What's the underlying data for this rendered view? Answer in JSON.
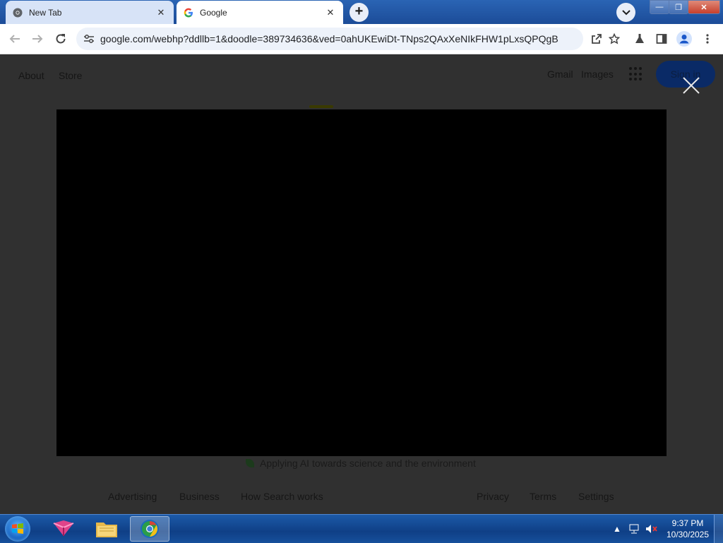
{
  "browser": {
    "tabs": [
      {
        "title": "New Tab",
        "favicon": "chrome-icon",
        "active": false
      },
      {
        "title": "Google",
        "favicon": "google-g-icon",
        "active": true
      }
    ],
    "new_tab_symbol": "+",
    "address_bar": {
      "url": "google.com/webhp?ddllb=1&doodle=389734636&ved=0ahUKEwiDt-TNps2QAxXeNIkFHW1pLxsQPQgB"
    },
    "window_controls": {
      "minimize": "—",
      "restore": "❐",
      "close": "✕"
    }
  },
  "page": {
    "top_left_links": [
      "About",
      "Store"
    ],
    "top_right_links": [
      "Gmail",
      "Images"
    ],
    "sign_in_label": "Sign in",
    "promo_text": "Applying AI towards science and the environment",
    "footer_left": [
      "Advertising",
      "Business",
      "How Search works"
    ],
    "footer_right": [
      "Privacy",
      "Terms",
      "Settings"
    ]
  },
  "taskbar": {
    "apps": [
      "start-orb-icon",
      "app-cube-icon",
      "file-explorer-icon",
      "chrome-icon"
    ],
    "clock": {
      "time": "9:37 PM",
      "date": "10/30/2025"
    }
  }
}
